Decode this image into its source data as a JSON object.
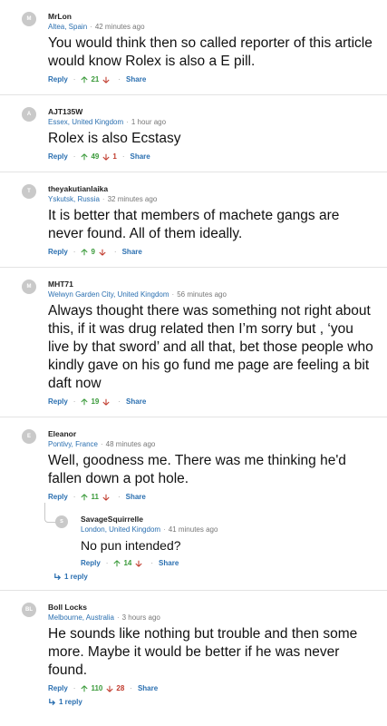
{
  "colors": {
    "link": "#2a6fb0",
    "upvote": "#3a9a3a",
    "downvote": "#c0392b",
    "avatar": "#c9c9c9"
  },
  "labels": {
    "reply": "Reply",
    "share": "Share",
    "dot": "·"
  },
  "comments": [
    {
      "initial": "M",
      "username": "MrLon",
      "location": "Altea, Spain",
      "time": "42 minutes ago",
      "text": "You would think then so called reporter of this article would know Rolex is also a E pill.",
      "up": "21",
      "down": ""
    },
    {
      "initial": "A",
      "username": "AJT135W",
      "location": "Essex, United Kingdom",
      "time": "1 hour ago",
      "text": "Rolex is also Ecstasy",
      "up": "49",
      "down": "1"
    },
    {
      "initial": "T",
      "username": "theyakutianlaika",
      "location": "Yskutsk, Russia",
      "time": "32 minutes ago",
      "text": "It is better that members of machete gangs are never found. All of them ideally.",
      "up": "9",
      "down": ""
    },
    {
      "initial": "M",
      "username": "MHT71",
      "location": "Welwyn Garden City, United Kingdom",
      "time": "56 minutes ago",
      "text": "Always thought there was something not right about this, if it was drug related then I’m sorry but , ‘you live by that sword’ and all that, bet those people who kindly gave on his go fund me page are feeling a bit daft now",
      "up": "19",
      "down": ""
    },
    {
      "initial": "E",
      "username": "Eleanor",
      "location": "Pontivy, France",
      "time": "48 minutes ago",
      "text": "Well, goodness me.  There was me thinking he'd fallen down a pot hole.",
      "up": "11",
      "down": "",
      "reply": {
        "initial": "S",
        "username": "SavageSquirrelle",
        "location": "London, United Kingdom",
        "time": "41 minutes ago",
        "text": "No pun intended?",
        "up": "14",
        "down": ""
      },
      "replies_label": "1 reply"
    },
    {
      "initial": "BL",
      "username": "Boll Locks",
      "location": "Melbourne, Australia",
      "time": "3 hours ago",
      "text": "He sounds like nothing but trouble and then some more. Maybe it would be better if he was never found.",
      "up": "110",
      "down": "28",
      "replies_label": "1 reply"
    }
  ]
}
